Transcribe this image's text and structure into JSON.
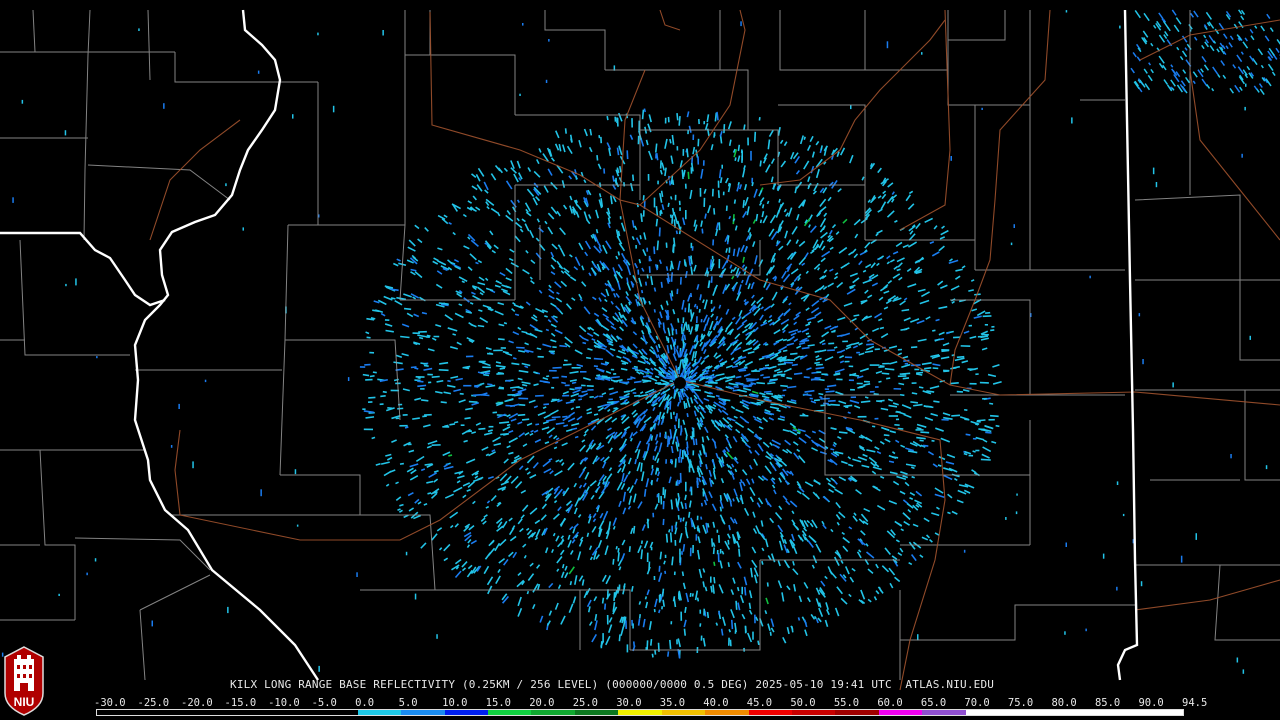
{
  "map": {
    "station_marker": "radar-site",
    "colors": {
      "background": "#000000",
      "county_lines": "#9a9a9a",
      "state_lines": "#ffffff",
      "highways": "#a0522d",
      "echo_light": "#22c4e8",
      "echo_mid": "#1a7cf0",
      "echo_green": "#10c040"
    }
  },
  "caption": {
    "text": "KILX LONG RANGE BASE REFLECTIVITY (0.25KM / 256 LEVEL) (000000/0000 0.5 DEG) 2025-05-10 19:41 UTC  ATLAS.NIU.EDU"
  },
  "legend": {
    "ticks": [
      "-30.0",
      "-25.0",
      "-20.0",
      "-15.0",
      "-10.0",
      "-5.0",
      "0.0",
      "5.0",
      "10.0",
      "15.0",
      "20.0",
      "25.0",
      "30.0",
      "35.0",
      "40.0",
      "45.0",
      "50.0",
      "55.0",
      "60.0",
      "65.0",
      "70.0",
      "75.0",
      "80.0",
      "85.0",
      "90.0",
      "94.5"
    ],
    "colors": [
      "#000000",
      "#000000",
      "#000000",
      "#000000",
      "#000000",
      "#000000",
      "#1ec8e6",
      "#1a8cf0",
      "#0020f0",
      "#10d040",
      "#10a830",
      "#0c7820",
      "#f0f000",
      "#f0c000",
      "#f08c00",
      "#f00000",
      "#c80000",
      "#a00000",
      "#f000f0",
      "#9050d0",
      "#ffffff",
      "#ffffff",
      "#ffffff",
      "#ffffff",
      "#ffffff"
    ]
  },
  "logo": {
    "text": "NIU",
    "icon": "niu-tower-logo"
  }
}
